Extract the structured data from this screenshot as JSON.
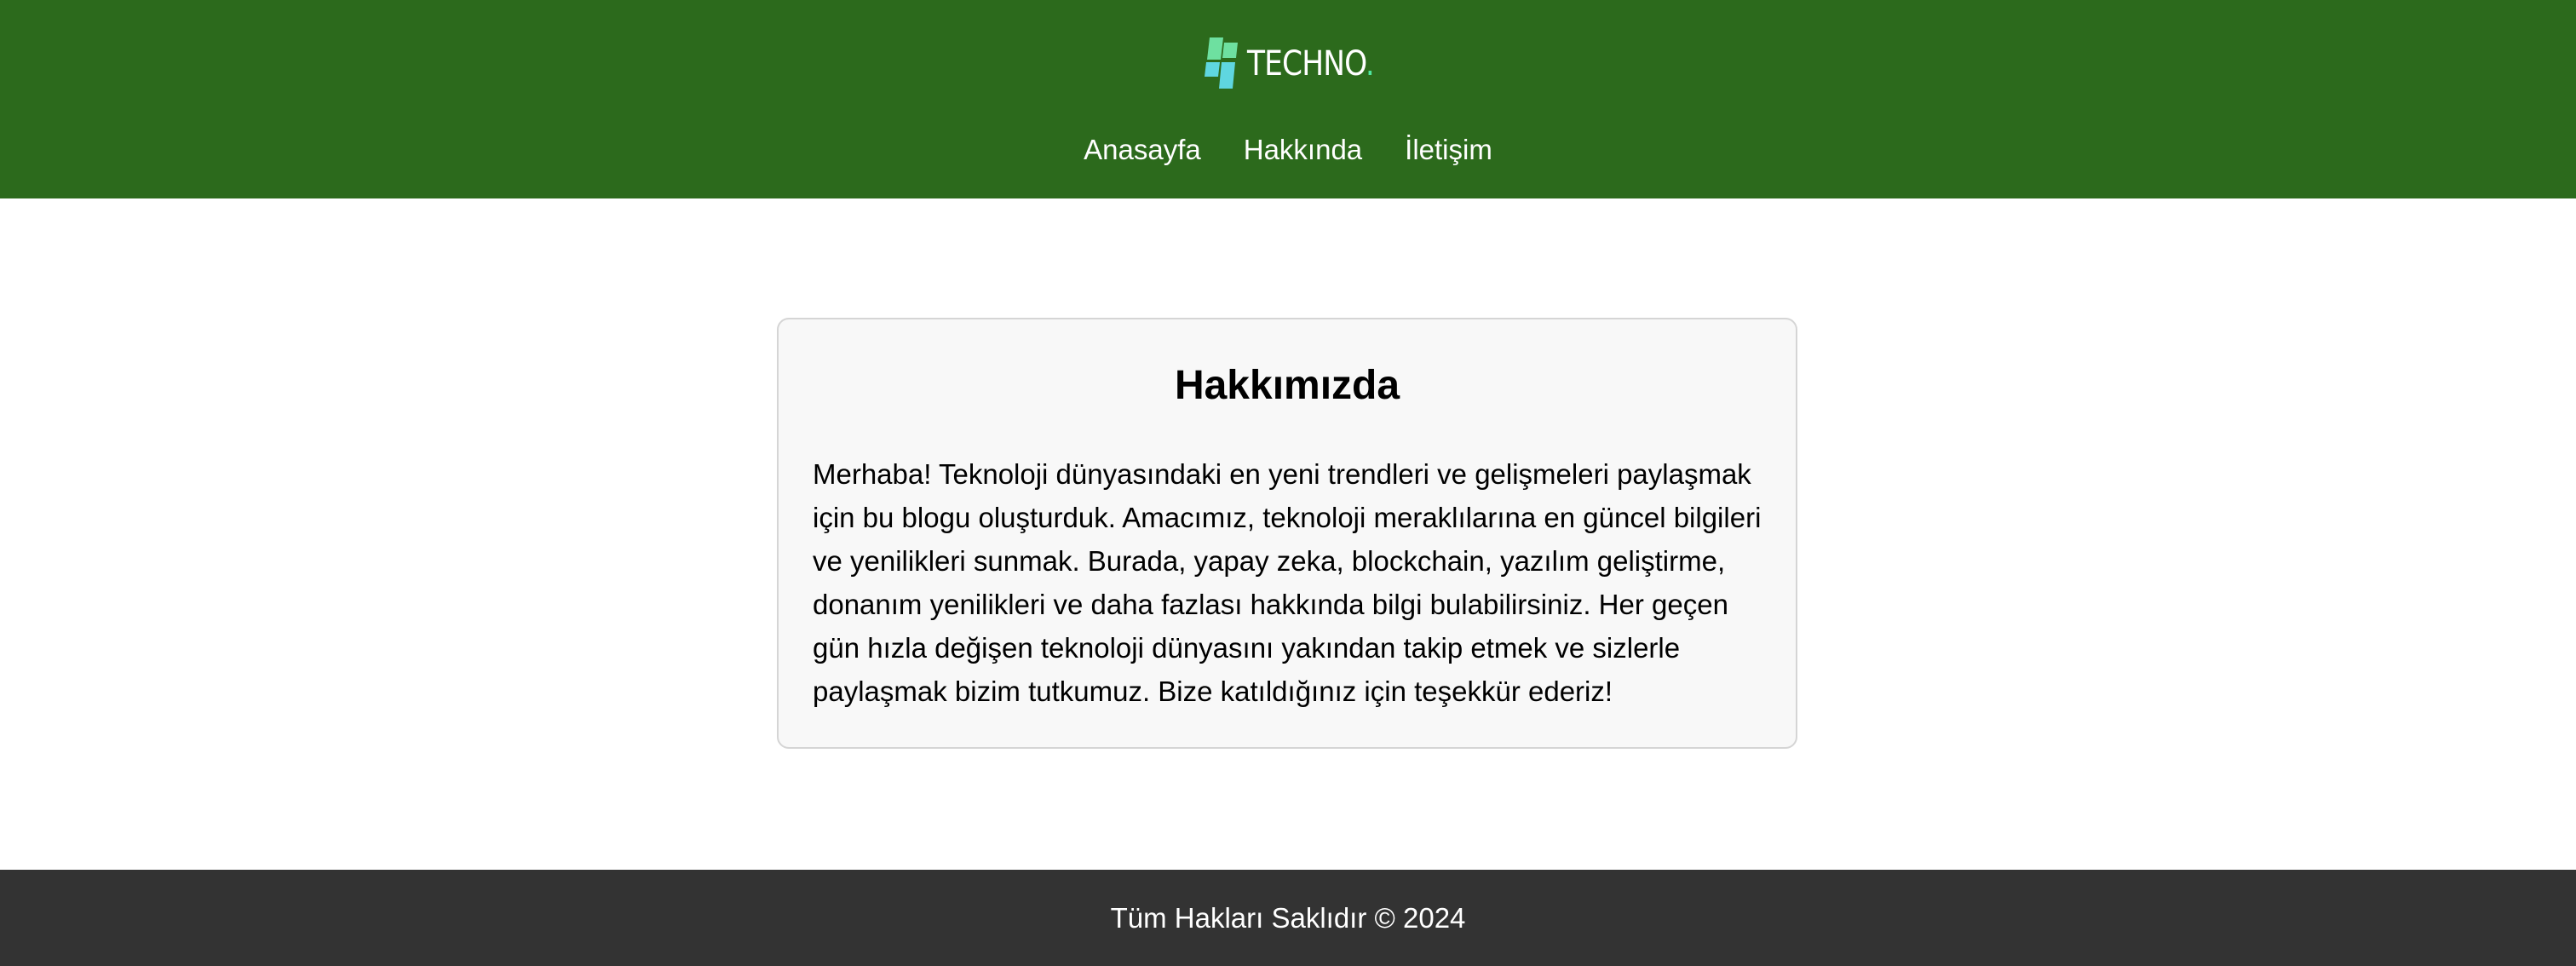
{
  "header": {
    "logo_text": "TECHNO",
    "logo_dot": ".",
    "background_color": "#2c6a1c",
    "logo_icon": "techno-logo-icon",
    "nav": {
      "items": [
        {
          "label": "Anasayfa"
        },
        {
          "label": "Hakkında"
        },
        {
          "label": "İletişim"
        }
      ]
    }
  },
  "main": {
    "title": "Hakkımızda",
    "body": "Merhaba! Teknoloji dünyasındaki en yeni trendleri ve gelişmeleri paylaşmak için bu blogu oluşturduk. Amacımız, teknoloji meraklılarına en güncel bilgileri ve yenilikleri sunmak. Burada, yapay zeka, blockchain, yazılım geliştirme, donanım yenilikleri ve daha fazlası hakkında bilgi bulabilirsiniz. Her geçen gün hızla değişen teknoloji dünyasını yakından takip etmek ve sizlerle paylaşmak bizim tutkumuz. Bize katıldığınız için teşekkür ederiz!"
  },
  "footer": {
    "text": "Tüm Hakları Saklıdır © 2024",
    "background_color": "#333333"
  }
}
